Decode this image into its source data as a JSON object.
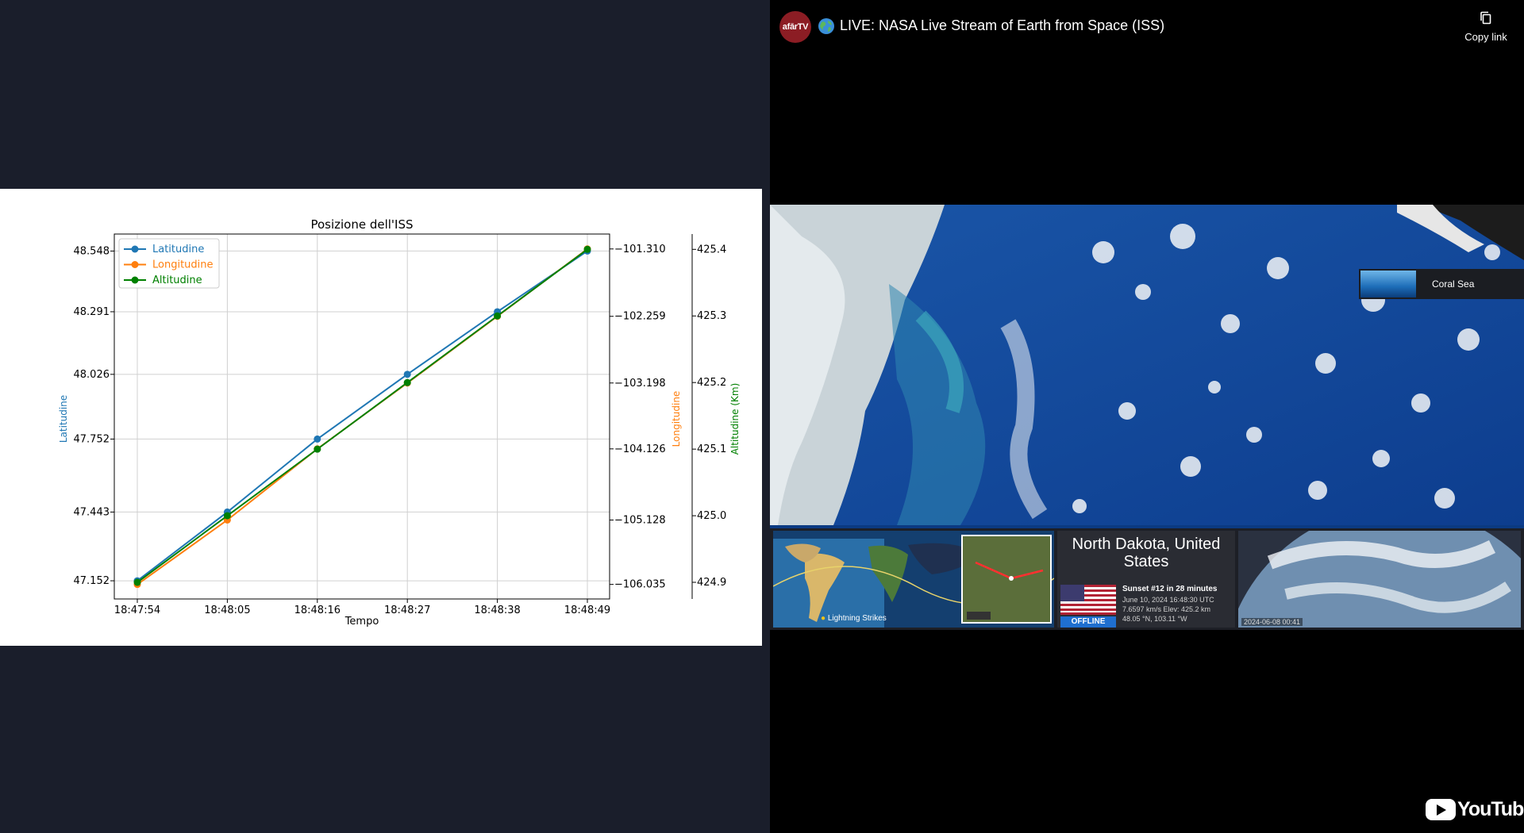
{
  "video": {
    "channel_avatar_text": "afārTV",
    "globe_icon": "globe-icon",
    "title": "LIVE: NASA Live Stream of Earth from Space (ISS)",
    "copy_link_label": "Copy link",
    "brand": "YouTube",
    "overlay": {
      "location": "North Dakota, United States",
      "sunset": "Sunset #12 in 28 minutes",
      "line1": "June 10, 2024    16:48:30 UTC",
      "line2": "7.6597 km/s   Elev: 425.2 km",
      "line3": "48.05 °N, 103.11 °W",
      "status": "OFFLINE",
      "lightning": "Lightning Strikes",
      "thumb_date": "2024-06-08 00:41",
      "place_card": "Coral Sea"
    }
  },
  "chart_data": {
    "type": "line",
    "title": "Posizione dell'ISS",
    "xlabel": "Tempo",
    "x": [
      "18:47:54",
      "18:48:05",
      "18:48:16",
      "18:48:27",
      "18:48:38",
      "18:48:49"
    ],
    "grid": true,
    "legend_position": "top-left",
    "colors": {
      "lat": "#1f77b4",
      "lon": "#ff7f0e",
      "alt": "#008000"
    },
    "axes": {
      "left": {
        "label": "Latitudine",
        "ticks": [
          "47.152",
          "47.443",
          "47.752",
          "48.026",
          "48.291",
          "48.548"
        ],
        "ylim": [
          47.075,
          48.62
        ]
      },
      "right1": {
        "label": "Longitudine",
        "ticks": [
          "−106.035",
          "−105.128",
          "−104.126",
          "−103.198",
          "−102.259",
          "−101.310"
        ],
        "ylim": [
          -106.24,
          -101.1
        ]
      },
      "right2": {
        "label": "Altitudine (Km)",
        "ticks": [
          "424.9",
          "425.0",
          "425.1",
          "425.2",
          "425.3",
          "425.4"
        ],
        "ylim": [
          424.875,
          425.423
        ]
      }
    },
    "series": [
      {
        "name": "Latitudine",
        "axis": "left",
        "values": [
          47.152,
          47.443,
          47.752,
          48.026,
          48.291,
          48.548
        ]
      },
      {
        "name": "Longitudine",
        "axis": "right1",
        "values": [
          -106.035,
          -105.128,
          -104.126,
          -103.198,
          -102.259,
          -101.31
        ]
      },
      {
        "name": "Altitudine",
        "axis": "right2",
        "values": [
          424.9,
          425.0,
          425.1,
          425.2,
          425.3,
          425.4
        ]
      }
    ]
  }
}
